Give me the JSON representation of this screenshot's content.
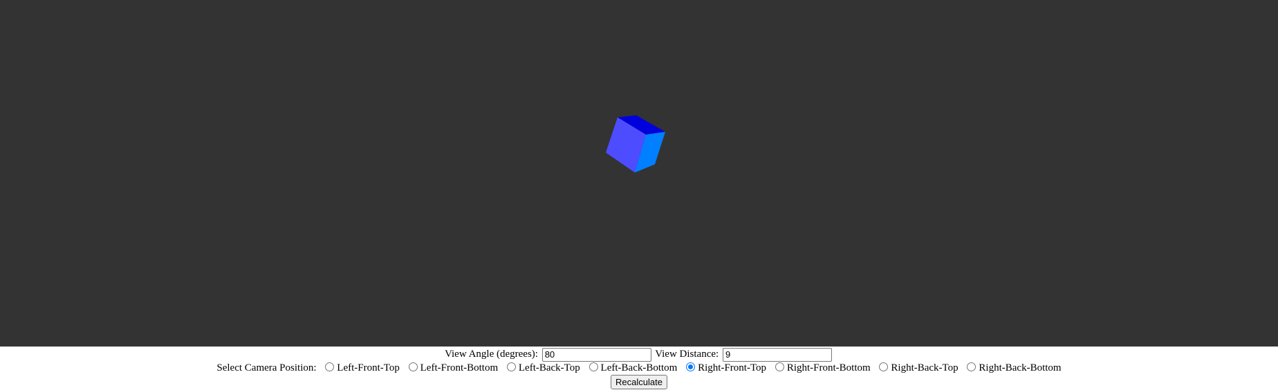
{
  "scene": {
    "background_color": "#333333",
    "cube_colors": {
      "front": "#4d4dff",
      "top": "#0000dd",
      "right": "#0080ff"
    }
  },
  "controls": {
    "view_angle_label": "View Angle (degrees):",
    "view_angle_value": "80",
    "view_distance_label": "View Distance:",
    "view_distance_value": "9",
    "camera_position_label": "Select Camera Position:",
    "camera_positions": [
      {
        "label": "Left-Front-Top",
        "checked": false
      },
      {
        "label": "Left-Front-Bottom",
        "checked": false
      },
      {
        "label": "Left-Back-Top",
        "checked": false
      },
      {
        "label": "Left-Back-Bottom",
        "checked": false
      },
      {
        "label": "Right-Front-Top",
        "checked": true
      },
      {
        "label": "Right-Front-Bottom",
        "checked": false
      },
      {
        "label": "Right-Back-Top",
        "checked": false
      },
      {
        "label": "Right-Back-Bottom",
        "checked": false
      }
    ],
    "recalculate_label": "Recalculate",
    "accent_color": "#0075ff"
  }
}
